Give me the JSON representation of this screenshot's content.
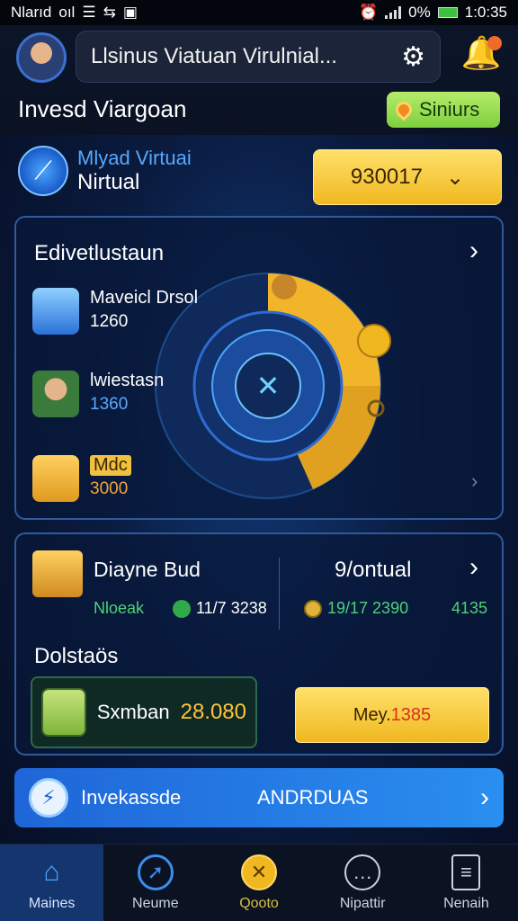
{
  "status_bar": {
    "left_text": "Nlarıd",
    "left_mid": "oıl",
    "battery_pct": "0%",
    "time": "1:0:35"
  },
  "header": {
    "search_text": "Llsinus Viatuan Virulnial...",
    "page_title": "Invesd Viargoan",
    "status_label": "Siniurs"
  },
  "brand": {
    "line1": "Mlyad Virtuai",
    "line2": "Nirtual",
    "balance": "930017"
  },
  "panel1": {
    "title": "Edivetlustaun",
    "items": [
      {
        "name": "Maveicl Drsol",
        "value": "1260",
        "value_color": "#ffffff"
      },
      {
        "name": "lwiestasn",
        "value": "1360",
        "value_color": "#5aa8ff"
      },
      {
        "name": "Mdc",
        "value": "3000",
        "value_color": "#f2a33a"
      }
    ]
  },
  "panel2": {
    "title_left": "Diayne Bud",
    "title_right": "9/ontual",
    "stat1": "Nloeak",
    "stat2": "11/7 3238",
    "stat3": "19/17 2390",
    "stat4": "4135",
    "section_label": "Dolstaös",
    "wallet_name": "Sxmban",
    "wallet_amount": "28.080",
    "button_prefix": "Mey.",
    "button_amount": "1385"
  },
  "banner": {
    "text_left": "Invekassde",
    "text_right": "ANDRDUAS"
  },
  "nav": [
    {
      "label": "Maines",
      "icon": "home-icon"
    },
    {
      "label": "Neume",
      "icon": "compass-icon"
    },
    {
      "label": "Qooto",
      "icon": "coin-icon"
    },
    {
      "label": "Nipattir",
      "icon": "chat-icon"
    },
    {
      "label": "Nenaih",
      "icon": "clipboard-icon"
    }
  ],
  "colors": {
    "accent_blue": "#2a8ef0",
    "gold": "#f0b820",
    "green_text": "#4fd07a"
  }
}
